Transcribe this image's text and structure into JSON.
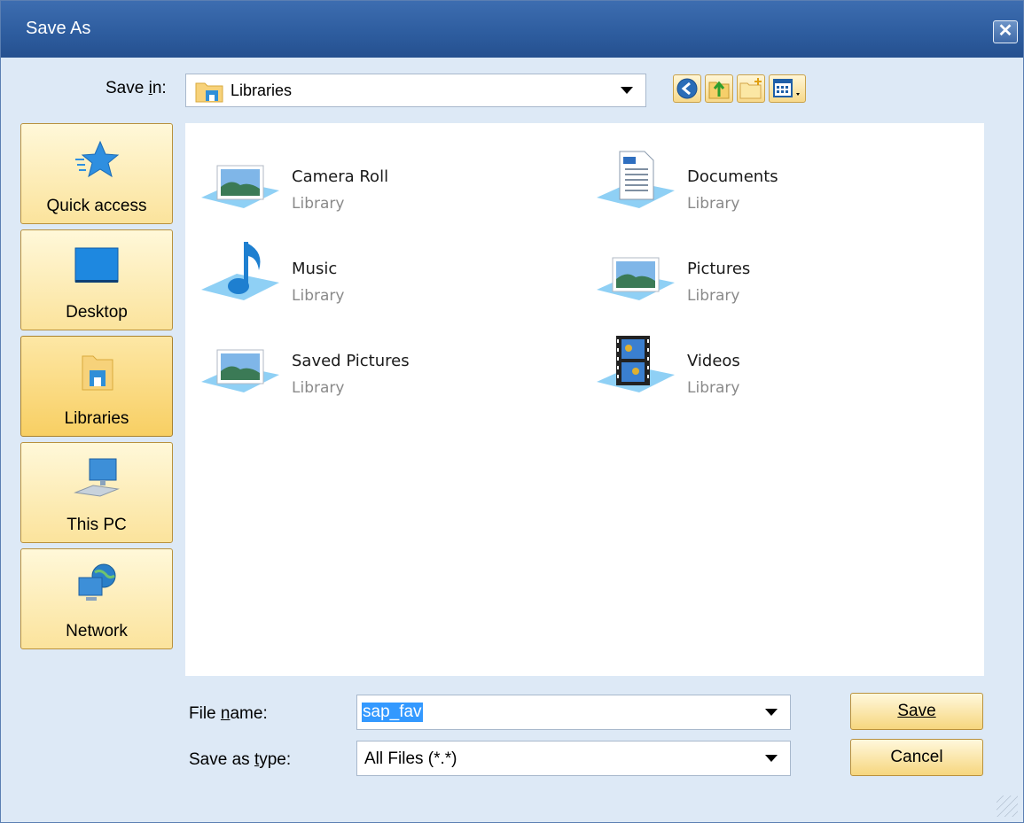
{
  "window": {
    "title": "Save As",
    "close_symbol": "✕"
  },
  "toolbar": {
    "save_in_label": "Save in:",
    "save_in_value": "Libraries",
    "buttons": [
      {
        "icon": "back-icon",
        "label": "Back"
      },
      {
        "icon": "up-folder-icon",
        "label": "Up One Level"
      },
      {
        "icon": "new-folder-icon",
        "label": "Create New Folder"
      },
      {
        "icon": "view-menu-icon",
        "label": "View Menu"
      }
    ]
  },
  "places": [
    {
      "label": "Quick access",
      "icon": "star-icon",
      "selected": false
    },
    {
      "label": "Desktop",
      "icon": "desktop-icon",
      "selected": false
    },
    {
      "label": "Libraries",
      "icon": "libraries-icon",
      "selected": true
    },
    {
      "label": "This PC",
      "icon": "computer-icon",
      "selected": false
    },
    {
      "label": "Network",
      "icon": "network-icon",
      "selected": false
    }
  ],
  "items": [
    {
      "name": "Camera Roll",
      "type": "Library",
      "icon": "pictures-library-icon"
    },
    {
      "name": "Documents",
      "type": "Library",
      "icon": "documents-library-icon"
    },
    {
      "name": "Music",
      "type": "Library",
      "icon": "music-library-icon"
    },
    {
      "name": "Pictures",
      "type": "Library",
      "icon": "pictures-library-icon"
    },
    {
      "name": "Saved Pictures",
      "type": "Library",
      "icon": "pictures-library-icon"
    },
    {
      "name": "Videos",
      "type": "Library",
      "icon": "videos-library-icon"
    }
  ],
  "form": {
    "file_name_label": "File name:",
    "file_name_value": "sap_fav",
    "type_label": "Save as type:",
    "type_value": "All Files (*.*)"
  },
  "actions": {
    "save": "Save",
    "cancel": "Cancel"
  },
  "colors": {
    "title_bar": "#2d5c9e",
    "selection": "#3399ff",
    "button_face": "#fbe39c",
    "dialog_bg": "#dde9f6"
  }
}
